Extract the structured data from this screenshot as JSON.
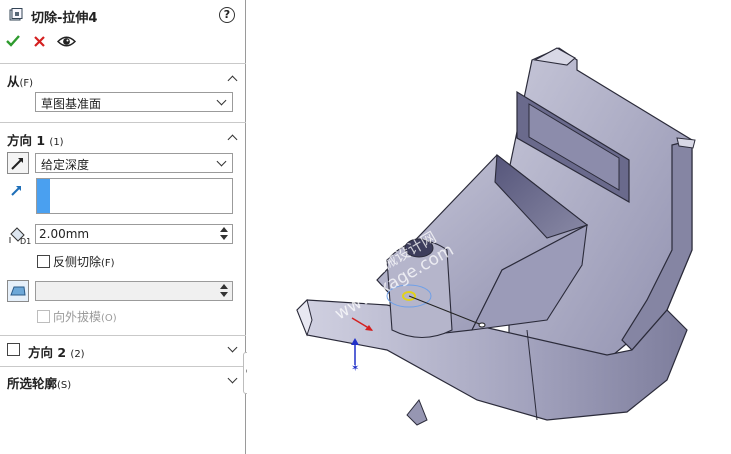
{
  "panel": {
    "title": "切除-拉伸4",
    "help_icon": "?",
    "from_section": {
      "label": "从",
      "key": "(F)",
      "dropdown_value": "草图基准面"
    },
    "direction1": {
      "label": "方向 1",
      "key": "(1)",
      "end_condition": "给定深度",
      "depth_value": "2.00mm",
      "flip_side_label": "反侧切除",
      "flip_side_key": "(F)",
      "draft_outward_label": "向外拔模",
      "draft_outward_key": "(O)"
    },
    "direction2": {
      "label": "方向 2",
      "key": "(2)"
    },
    "selected_contours": {
      "label": "所选轮廓",
      "key": "(S)"
    }
  },
  "viewport": {
    "watermark": "www.jxage.com",
    "watermark2": "机械设计网"
  },
  "colors": {
    "accept": "#2e9b2e",
    "cancel": "#d42020",
    "selection_blue": "#4aa0f0",
    "model": "#a9a9c4"
  }
}
